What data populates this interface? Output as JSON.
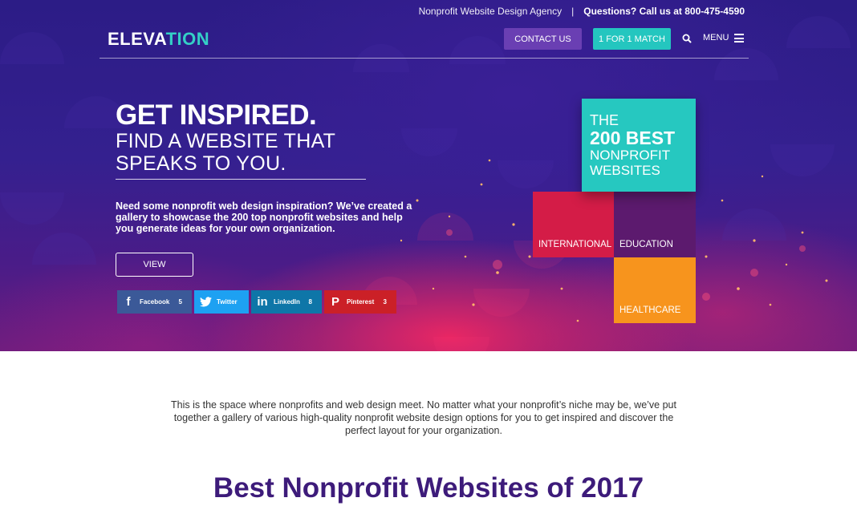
{
  "utility": {
    "agency": "Nonprofit Website Design Agency",
    "separator": "|",
    "phone": "Questions? Call us at 800-475-4590"
  },
  "nav": {
    "logo_main": "ELEVA",
    "logo_accent": "TION",
    "contact_label": "CONTACT US",
    "match_label": "1 FOR 1 MATCH",
    "search_icon": "search-icon",
    "menu_label": "MENU",
    "menu_icon": "hamburger-icon"
  },
  "hero": {
    "headline": "GET INSPIRED.",
    "sub_line1": "FIND A WEBSITE THAT",
    "sub_line2": "SPEAKS TO YOU.",
    "intro": "Need some nonprofit web design inspiration? We’ve created a gallery to showcase the 200 top nonprofit websites and help you generate ideas for your own organization.",
    "view_label": "VIEW",
    "share": [
      {
        "network": "Facebook",
        "icon": "facebook-icon",
        "glyph": "f",
        "count": "5",
        "color": "#3b5998"
      },
      {
        "network": "Twitter",
        "icon": "twitter-icon",
        "glyph": "t",
        "count": "",
        "color": "#1da1f2"
      },
      {
        "network": "LinkedIn",
        "icon": "linkedin-icon",
        "glyph": "in",
        "count": "8",
        "color": "#0e76a8"
      },
      {
        "network": "Pinterest",
        "icon": "pinterest-icon",
        "glyph": "P",
        "count": "3",
        "color": "#cb2027"
      }
    ]
  },
  "tiles": {
    "best_line1": "THE",
    "best_line2": "200 BEST",
    "best_line3": "NONPROFIT",
    "best_line4": "WEBSITES",
    "international": "INTERNATIONAL",
    "education": "EDUCATION",
    "healthcare": "HEALTHCARE",
    "colors": {
      "best": "#26c8c0",
      "international": "#d41c47",
      "education": "#5c1a6e",
      "healthcare": "#f7941d"
    }
  },
  "main": {
    "blurb": "This is the space where nonprofits and web design meet. No matter what your nonprofit’s niche may be, we’ve put together a gallery of various high-quality nonprofit website design options for you to get inspired and discover the perfect layout for your organization.",
    "section_title": "Best Nonprofit Websites of 2017"
  },
  "colors": {
    "brand_purple": "#3d1b7a",
    "accent_teal": "#34d0c6",
    "contact_purple": "#6a3fb3"
  }
}
